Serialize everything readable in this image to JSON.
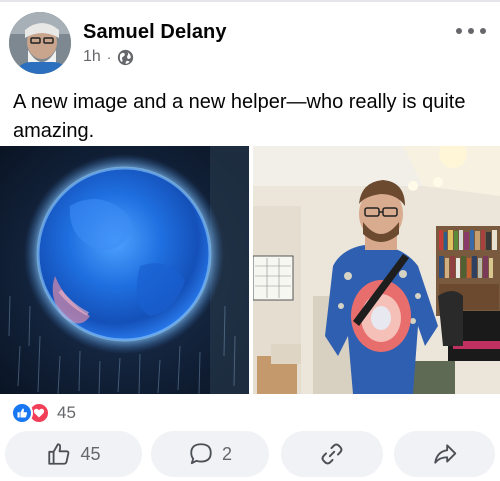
{
  "post": {
    "author": "Samuel Delany",
    "time": "1h",
    "separator": "·",
    "visibility_icon": "globe-icon",
    "more_icon": "more-dots-icon",
    "text": "A new image and a new helper—who really is quite amazing."
  },
  "images": [
    {
      "name": "planet-image",
      "description_icon": "photo"
    },
    {
      "name": "person-photo",
      "description_icon": "photo"
    }
  ],
  "reactions": {
    "types": [
      "like-icon",
      "love-icon"
    ],
    "count": "45"
  },
  "actions": {
    "like_count": "45",
    "comment_count": "2"
  },
  "colors": {
    "accent": "#1877f2",
    "love": "#f33e58",
    "secondary_text": "#65676b",
    "button_bg": "#f0f2f5"
  }
}
